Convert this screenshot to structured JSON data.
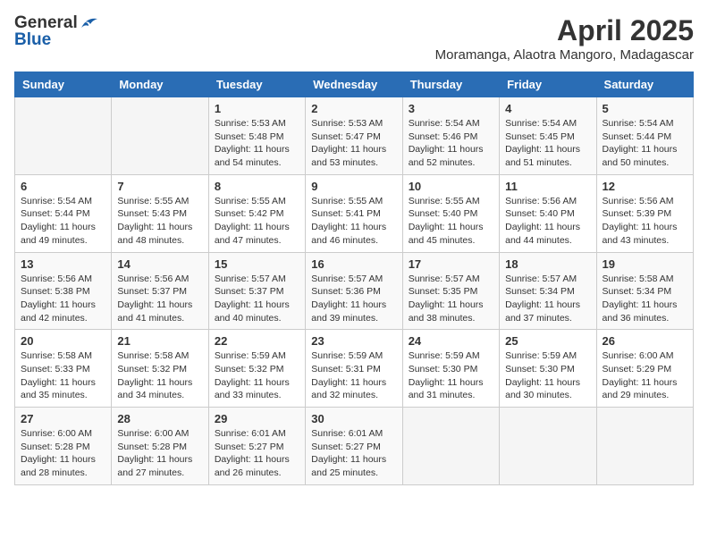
{
  "header": {
    "logo_general": "General",
    "logo_blue": "Blue",
    "month": "April 2025",
    "location": "Moramanga, Alaotra Mangoro, Madagascar"
  },
  "weekdays": [
    "Sunday",
    "Monday",
    "Tuesday",
    "Wednesday",
    "Thursday",
    "Friday",
    "Saturday"
  ],
  "weeks": [
    [
      {
        "day": "",
        "info": ""
      },
      {
        "day": "",
        "info": ""
      },
      {
        "day": "1",
        "info": "Sunrise: 5:53 AM\nSunset: 5:48 PM\nDaylight: 11 hours and 54 minutes."
      },
      {
        "day": "2",
        "info": "Sunrise: 5:53 AM\nSunset: 5:47 PM\nDaylight: 11 hours and 53 minutes."
      },
      {
        "day": "3",
        "info": "Sunrise: 5:54 AM\nSunset: 5:46 PM\nDaylight: 11 hours and 52 minutes."
      },
      {
        "day": "4",
        "info": "Sunrise: 5:54 AM\nSunset: 5:45 PM\nDaylight: 11 hours and 51 minutes."
      },
      {
        "day": "5",
        "info": "Sunrise: 5:54 AM\nSunset: 5:44 PM\nDaylight: 11 hours and 50 minutes."
      }
    ],
    [
      {
        "day": "6",
        "info": "Sunrise: 5:54 AM\nSunset: 5:44 PM\nDaylight: 11 hours and 49 minutes."
      },
      {
        "day": "7",
        "info": "Sunrise: 5:55 AM\nSunset: 5:43 PM\nDaylight: 11 hours and 48 minutes."
      },
      {
        "day": "8",
        "info": "Sunrise: 5:55 AM\nSunset: 5:42 PM\nDaylight: 11 hours and 47 minutes."
      },
      {
        "day": "9",
        "info": "Sunrise: 5:55 AM\nSunset: 5:41 PM\nDaylight: 11 hours and 46 minutes."
      },
      {
        "day": "10",
        "info": "Sunrise: 5:55 AM\nSunset: 5:40 PM\nDaylight: 11 hours and 45 minutes."
      },
      {
        "day": "11",
        "info": "Sunrise: 5:56 AM\nSunset: 5:40 PM\nDaylight: 11 hours and 44 minutes."
      },
      {
        "day": "12",
        "info": "Sunrise: 5:56 AM\nSunset: 5:39 PM\nDaylight: 11 hours and 43 minutes."
      }
    ],
    [
      {
        "day": "13",
        "info": "Sunrise: 5:56 AM\nSunset: 5:38 PM\nDaylight: 11 hours and 42 minutes."
      },
      {
        "day": "14",
        "info": "Sunrise: 5:56 AM\nSunset: 5:37 PM\nDaylight: 11 hours and 41 minutes."
      },
      {
        "day": "15",
        "info": "Sunrise: 5:57 AM\nSunset: 5:37 PM\nDaylight: 11 hours and 40 minutes."
      },
      {
        "day": "16",
        "info": "Sunrise: 5:57 AM\nSunset: 5:36 PM\nDaylight: 11 hours and 39 minutes."
      },
      {
        "day": "17",
        "info": "Sunrise: 5:57 AM\nSunset: 5:35 PM\nDaylight: 11 hours and 38 minutes."
      },
      {
        "day": "18",
        "info": "Sunrise: 5:57 AM\nSunset: 5:34 PM\nDaylight: 11 hours and 37 minutes."
      },
      {
        "day": "19",
        "info": "Sunrise: 5:58 AM\nSunset: 5:34 PM\nDaylight: 11 hours and 36 minutes."
      }
    ],
    [
      {
        "day": "20",
        "info": "Sunrise: 5:58 AM\nSunset: 5:33 PM\nDaylight: 11 hours and 35 minutes."
      },
      {
        "day": "21",
        "info": "Sunrise: 5:58 AM\nSunset: 5:32 PM\nDaylight: 11 hours and 34 minutes."
      },
      {
        "day": "22",
        "info": "Sunrise: 5:59 AM\nSunset: 5:32 PM\nDaylight: 11 hours and 33 minutes."
      },
      {
        "day": "23",
        "info": "Sunrise: 5:59 AM\nSunset: 5:31 PM\nDaylight: 11 hours and 32 minutes."
      },
      {
        "day": "24",
        "info": "Sunrise: 5:59 AM\nSunset: 5:30 PM\nDaylight: 11 hours and 31 minutes."
      },
      {
        "day": "25",
        "info": "Sunrise: 5:59 AM\nSunset: 5:30 PM\nDaylight: 11 hours and 30 minutes."
      },
      {
        "day": "26",
        "info": "Sunrise: 6:00 AM\nSunset: 5:29 PM\nDaylight: 11 hours and 29 minutes."
      }
    ],
    [
      {
        "day": "27",
        "info": "Sunrise: 6:00 AM\nSunset: 5:28 PM\nDaylight: 11 hours and 28 minutes."
      },
      {
        "day": "28",
        "info": "Sunrise: 6:00 AM\nSunset: 5:28 PM\nDaylight: 11 hours and 27 minutes."
      },
      {
        "day": "29",
        "info": "Sunrise: 6:01 AM\nSunset: 5:27 PM\nDaylight: 11 hours and 26 minutes."
      },
      {
        "day": "30",
        "info": "Sunrise: 6:01 AM\nSunset: 5:27 PM\nDaylight: 11 hours and 25 minutes."
      },
      {
        "day": "",
        "info": ""
      },
      {
        "day": "",
        "info": ""
      },
      {
        "day": "",
        "info": ""
      }
    ]
  ]
}
